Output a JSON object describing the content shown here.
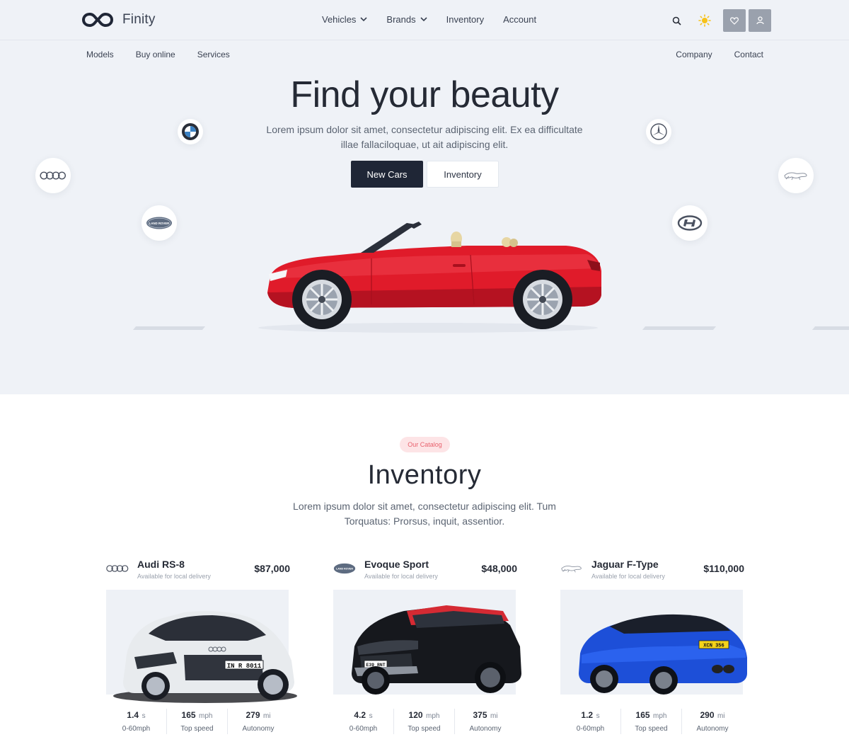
{
  "brand": {
    "name": "Finity"
  },
  "nav": {
    "main": [
      {
        "label": "Vehicles",
        "dropdown": true
      },
      {
        "label": "Brands",
        "dropdown": true
      },
      {
        "label": "Inventory",
        "dropdown": false
      },
      {
        "label": "Account",
        "dropdown": false
      }
    ],
    "sub_left": [
      "Models",
      "Buy online",
      "Services"
    ],
    "sub_right": [
      "Company",
      "Contact"
    ],
    "icons": [
      "search-icon",
      "sun-icon",
      "heart-icon",
      "user-icon"
    ]
  },
  "hero": {
    "title": "Find your beauty",
    "subtitle": "Lorem ipsum dolor sit amet, consectetur adipiscing elit. Ex ea difficultate illae fallaciloquae, ut ait adipiscing elit.",
    "primary_button": "New Cars",
    "secondary_button": "Inventory",
    "brand_logos": [
      "bmw",
      "audi",
      "land-rover",
      "mercedes",
      "jaguar",
      "hyundai"
    ],
    "land_rover_text": "LAND ROVER"
  },
  "catalog": {
    "badge": "Our Catalog",
    "title": "Inventory",
    "subtitle": "Lorem ipsum dolor sit amet, consectetur adipiscing elit. Tum Torquatus: Prorsus, inquit, assentior.",
    "cars": [
      {
        "brand": "audi",
        "name": "Audi RS-8",
        "availability": "Available for local delivery",
        "price": "$87,000",
        "color": "#eceff2",
        "plate": "IN R 8011",
        "stats": [
          {
            "value": "1.4",
            "unit": "s",
            "label": "0-60mph"
          },
          {
            "value": "165",
            "unit": "mph",
            "label": "Top speed"
          },
          {
            "value": "279",
            "unit": "mi",
            "label": "Autonomy"
          }
        ]
      },
      {
        "brand": "land-rover",
        "name": "Evoque Sport",
        "availability": "Available for local delivery",
        "price": "$48,000",
        "color": "#16181d",
        "plate": "E39 RNT",
        "stats": [
          {
            "value": "4.2",
            "unit": "s",
            "label": "0-60mph"
          },
          {
            "value": "120",
            "unit": "mph",
            "label": "Top speed"
          },
          {
            "value": "375",
            "unit": "mi",
            "label": "Autonomy"
          }
        ]
      },
      {
        "brand": "jaguar",
        "name": "Jaguar F-Type",
        "availability": "Available for local delivery",
        "price": "$110,000",
        "color": "#1d4fd8",
        "plate": "XCN 356",
        "stats": [
          {
            "value": "1.2",
            "unit": "s",
            "label": "0-60mph"
          },
          {
            "value": "165",
            "unit": "mph",
            "label": "Top speed"
          },
          {
            "value": "290",
            "unit": "mi",
            "label": "Autonomy"
          }
        ]
      }
    ]
  },
  "colors": {
    "hero_bg": "#eff2f7",
    "dark": "#1f2636",
    "accent_pink": "#e8626e",
    "hero_car": "#e01b2a"
  }
}
